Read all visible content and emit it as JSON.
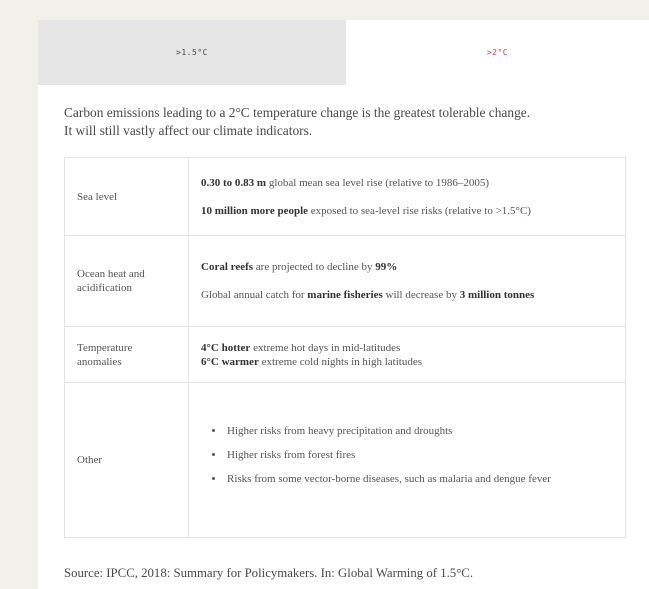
{
  "tabs": [
    {
      "label": ">1.5°C"
    },
    {
      "label": ">2°C"
    }
  ],
  "colors": {
    "active_tab_text": "#e0394a",
    "inactive_tab_bg": "#e6e6e6",
    "page_bg": "#f1f0ea"
  },
  "intro": {
    "line1": "Carbon emissions leading to a 2°C temperature change is the greatest tolerable change.",
    "line2": "It will still vastly affect our climate indicators."
  },
  "rows": {
    "sea": {
      "label": "Sea level",
      "l1_bold": "0.30 to 0.83 m",
      "l1_rest": " global mean sea level rise (relative to 1986–2005)",
      "l2_bold": "10 million more people",
      "l2_rest": " exposed to sea-level rise risks (relative to >1.5°C)"
    },
    "ocean": {
      "label": "Ocean heat and acidification",
      "l1_bold": "Coral reefs",
      "l1_mid": " are projected to decline by ",
      "l1_bold2": "99%",
      "l2_pre": "Global annual catch for ",
      "l2_bold": "marine fisheries",
      "l2_mid": " will decrease by ",
      "l2_bold2": "3 million tonnes"
    },
    "temp": {
      "label": "Temperature anomalies",
      "l1_bold": "4°C hotter",
      "l1_rest": " extreme hot days in mid-latitudes",
      "l2_bold": "6°C warmer",
      "l2_rest": " extreme cold nights in high latitudes"
    },
    "other": {
      "label": "Other",
      "items": [
        "Higher risks from heavy precipitation and droughts",
        "Higher risks from forest fires",
        "Risks from some vector-borne diseases, such as malaria and dengue fever"
      ]
    }
  },
  "source": "Source: IPCC, 2018: Summary for Policymakers. In: Global Warming of 1.5°C."
}
